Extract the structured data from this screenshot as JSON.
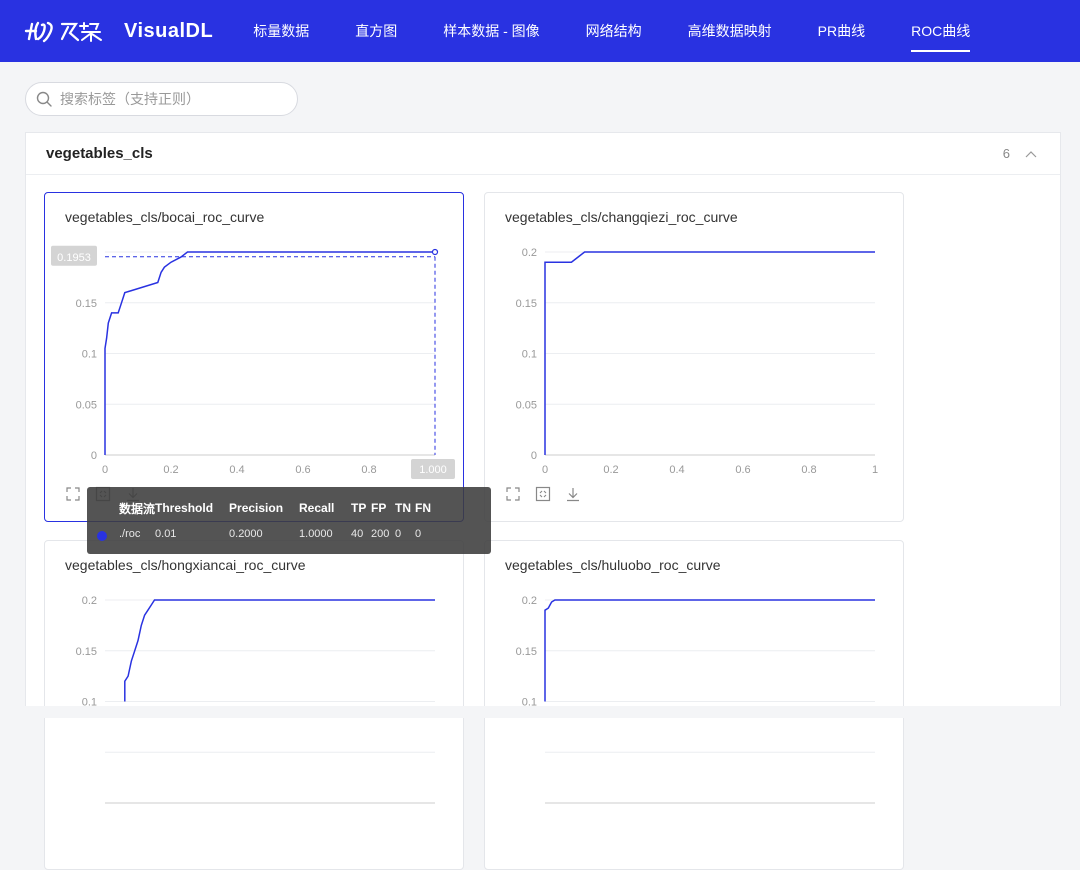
{
  "nav": {
    "brand": "VisualDL",
    "items": [
      {
        "label": "标量数据",
        "active": false
      },
      {
        "label": "直方图",
        "active": false
      },
      {
        "label": "样本数据 - 图像",
        "active": false
      },
      {
        "label": "网络结构",
        "active": false
      },
      {
        "label": "高维数据映射",
        "active": false
      },
      {
        "label": "PR曲线",
        "active": false
      },
      {
        "label": "ROC曲线",
        "active": true
      }
    ]
  },
  "search": {
    "placeholder": "搜索标签（支持正则）",
    "value": "",
    "icon": "search-icon"
  },
  "group": {
    "title": "vegetables_cls",
    "count": "6",
    "collapse_icon": "chevron-up-icon"
  },
  "colors": {
    "nav": "#2932e1",
    "line": "#2932e1",
    "active_border": "#2932e1"
  },
  "cards": [
    {
      "title": "vegetables_cls/bocai_roc_curve",
      "active": true,
      "tools": [
        "expand-icon",
        "fit-screen-icon",
        "download-icon"
      ],
      "chart_data": {
        "type": "line",
        "title": "vegetables_cls/bocai_roc_curve",
        "xlim": [
          0,
          1
        ],
        "ylim": [
          0,
          0.2
        ],
        "x_ticks": [
          "0",
          "0.2",
          "0.4",
          "0.6",
          "0.8",
          "1.000"
        ],
        "y_ticks": [
          "0",
          "0.05",
          "0.1",
          "0.15",
          "0.1953"
        ],
        "grid": true,
        "series": [
          {
            "x": [
              0,
              0,
              0.005,
              0.01,
              0.02,
              0.03,
              0.04,
              0.05,
              0.06,
              0.06,
              0.08,
              0.16,
              0.17,
              0.18,
              0.2,
              0.23,
              0.25,
              1.0
            ],
            "y": [
              0,
              0.105,
              0.115,
              0.13,
              0.14,
              0.14,
              0.14,
              0.15,
              0.16,
              0.16,
              0.162,
              0.17,
              0.18,
              0.185,
              0.19,
              0.195,
              0.2,
              0.2
            ]
          }
        ],
        "crosshair": {
          "x": 1.0,
          "y": 0.1953,
          "x_label": "1.000",
          "y_label": "0.1953"
        }
      }
    },
    {
      "title": "vegetables_cls/changqiezi_roc_curve",
      "active": false,
      "tools": [
        "expand-icon",
        "fit-screen-icon",
        "download-icon"
      ],
      "chart_data": {
        "type": "line",
        "title": "vegetables_cls/changqiezi_roc_curve",
        "xlim": [
          0,
          1
        ],
        "ylim": [
          0,
          0.2
        ],
        "x_ticks": [
          "0",
          "0.2",
          "0.4",
          "0.6",
          "0.8",
          "1"
        ],
        "y_ticks": [
          "0",
          "0.05",
          "0.1",
          "0.15",
          "0.2"
        ],
        "grid": true,
        "series": [
          {
            "x": [
              0,
              0,
              0.08,
              0.1,
              0.12,
              1.0
            ],
            "y": [
              0,
              0.19,
              0.19,
              0.195,
              0.2,
              0.2
            ]
          }
        ]
      }
    },
    {
      "title": "vegetables_cls/hongxiancai_roc_curve",
      "active": false,
      "tools": [],
      "chart_data": {
        "type": "line",
        "title": "vegetables_cls/hongxiancai_roc_curve",
        "xlim": [
          0,
          1
        ],
        "ylim": [
          0,
          0.2
        ],
        "x_ticks": [],
        "y_ticks": [
          "0.1",
          "0.15",
          "0.2"
        ],
        "grid": true,
        "series": [
          {
            "x": [
              0.06,
              0.06,
              0.07,
              0.08,
              0.09,
              0.1,
              0.11,
              0.12,
              0.13,
              0.14,
              0.15,
              1.0
            ],
            "y": [
              0.1,
              0.12,
              0.125,
              0.14,
              0.15,
              0.16,
              0.175,
              0.185,
              0.19,
              0.195,
              0.2,
              0.2
            ]
          }
        ]
      }
    },
    {
      "title": "vegetables_cls/huluobo_roc_curve",
      "active": false,
      "tools": [],
      "chart_data": {
        "type": "line",
        "title": "vegetables_cls/huluobo_roc_curve",
        "xlim": [
          0,
          1
        ],
        "ylim": [
          0,
          0.2
        ],
        "x_ticks": [],
        "y_ticks": [
          "0.1",
          "0.15",
          "0.2"
        ],
        "grid": true,
        "series": [
          {
            "x": [
              0,
              0,
              0.01,
              0.02,
              0.03,
              1.0
            ],
            "y": [
              0.1,
              0.19,
              0.192,
              0.198,
              0.2,
              0.2
            ]
          }
        ]
      }
    }
  ],
  "tooltip": {
    "headers": [
      "数据流",
      "Threshold",
      "Precision",
      "Recall",
      "TP",
      "FP",
      "TN",
      "FN"
    ],
    "row": {
      "run": "./roc",
      "values": [
        "0.01",
        "0.2000",
        "1.0000",
        "40",
        "200",
        "0",
        "0"
      ]
    },
    "dot_color": "#2932e1"
  }
}
